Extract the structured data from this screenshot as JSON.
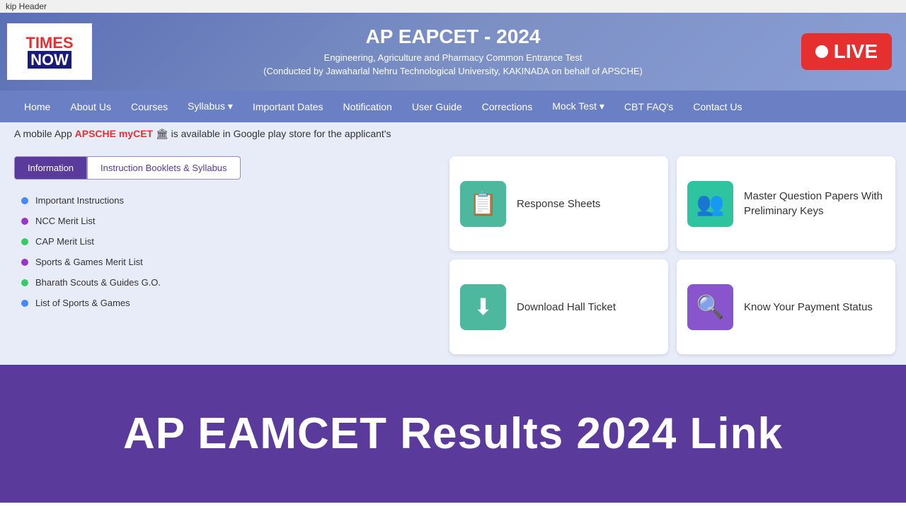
{
  "skip_header": {
    "text": "kip Header"
  },
  "site_header": {
    "logo_line1": "TIMES",
    "logo_line2": "NOW",
    "title": "AP EAPCET - 2024",
    "subtitle1": "Engineering, Agriculture and Pharmacy Common Entrance Test",
    "subtitle2": "(Conducted by Jawaharlal Nehru Technological University, KAKINADA on behalf of APSCHE)",
    "live_label": "LIVE"
  },
  "navbar": {
    "items": [
      {
        "label": "Home",
        "active": false
      },
      {
        "label": "About Us",
        "active": false
      },
      {
        "label": "Courses",
        "active": false
      },
      {
        "label": "Syllabus ▾",
        "active": false
      },
      {
        "label": "Important Dates",
        "active": false
      },
      {
        "label": "Notification",
        "active": false
      },
      {
        "label": "User Guide",
        "active": false
      },
      {
        "label": "Corrections",
        "active": false
      },
      {
        "label": "Mock Test ▾",
        "active": false
      },
      {
        "label": "CBT FAQ's",
        "active": false
      },
      {
        "label": "Contact Us",
        "active": false
      }
    ]
  },
  "marquee": {
    "text_before": "A mobile App ",
    "link_text": "APSCHE myCET",
    "text_after": " 🏛 is available in Google play store for the applicant's"
  },
  "left_panel": {
    "tabs": [
      {
        "label": "Information",
        "active": true
      },
      {
        "label": "Instruction Booklets & Syllabus",
        "active": false
      }
    ],
    "list_items": [
      {
        "text": "Important Instructions",
        "dot_color": "blue"
      },
      {
        "text": "NCC Merit List",
        "dot_color": "purple"
      },
      {
        "text": "CAP Merit List",
        "dot_color": "green"
      },
      {
        "text": "Sports & Games Merit List",
        "dot_color": "purple"
      },
      {
        "text": "Bharath Scouts & Guides G.O.",
        "dot_color": "green"
      },
      {
        "text": "List of Sports & Games",
        "dot_color": "blue"
      }
    ]
  },
  "right_panel": {
    "cards": [
      {
        "label": "Response Sheets",
        "icon": "📋",
        "icon_class": "card-icon-green"
      },
      {
        "label": "Master Question Papers With Preliminary Keys",
        "icon": "👥",
        "icon_class": "card-icon-teal"
      },
      {
        "label": "Download Hall Ticket",
        "icon": "⬇",
        "icon_class": "card-icon-green"
      },
      {
        "label": "Know Your Payment Status",
        "icon": "🔍",
        "icon_class": "card-icon-purple"
      }
    ]
  },
  "bottom_banner": {
    "text": "AP EAMCET Results 2024 Link"
  }
}
